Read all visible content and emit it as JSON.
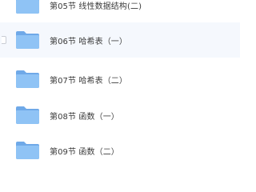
{
  "file_list": {
    "items": [
      {
        "name": "第05节 线性数据结构(二)",
        "icon": "folder-icon",
        "selected": false
      },
      {
        "name": "第06节 哈希表（一）",
        "icon": "folder-icon",
        "selected": false
      },
      {
        "name": "第07节 哈希表（二）",
        "icon": "folder-icon",
        "selected": false
      },
      {
        "name": "第08节 函数（一）",
        "icon": "folder-icon",
        "selected": false
      },
      {
        "name": "第09节 函数（二）",
        "icon": "folder-icon",
        "selected": false
      }
    ]
  },
  "colors": {
    "folder_body": "#8fc3f5",
    "folder_tab": "#6fa9e8",
    "hover_background": "#f5f8fd",
    "text": "#3a3a3a"
  }
}
